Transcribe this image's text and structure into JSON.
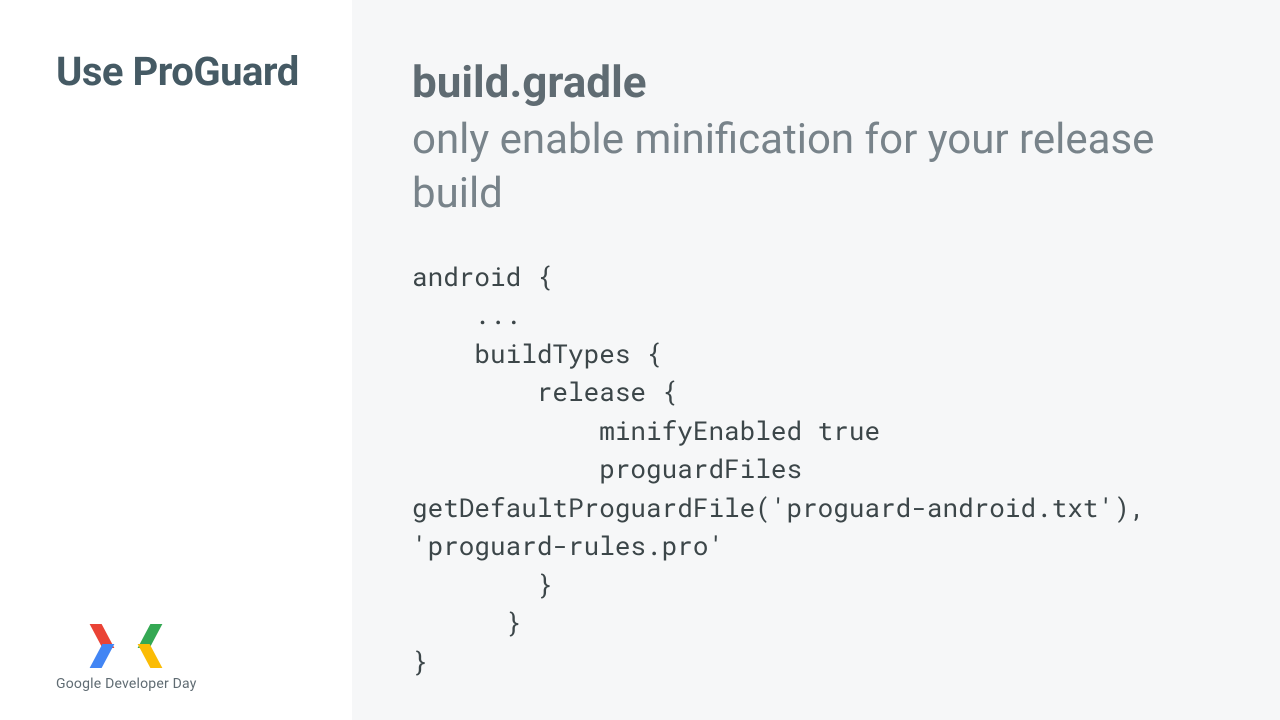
{
  "left": {
    "title": "Use ProGuard",
    "footer_text": "Google Developer Day"
  },
  "right": {
    "file_name": "build.gradle",
    "subtitle": "only enable minification for your release build",
    "code": "android {\n    ...\n    buildTypes {\n        release {\n            minifyEnabled true\n            proguardFiles\ngetDefaultProguardFile('proguard-android.txt'),\n'proguard-rules.pro'\n        }\n      }\n}"
  },
  "colors": {
    "leftBg": "#ffffff",
    "rightBg": "#f6f7f8",
    "heading": "#455a64",
    "body": "#78838a"
  }
}
